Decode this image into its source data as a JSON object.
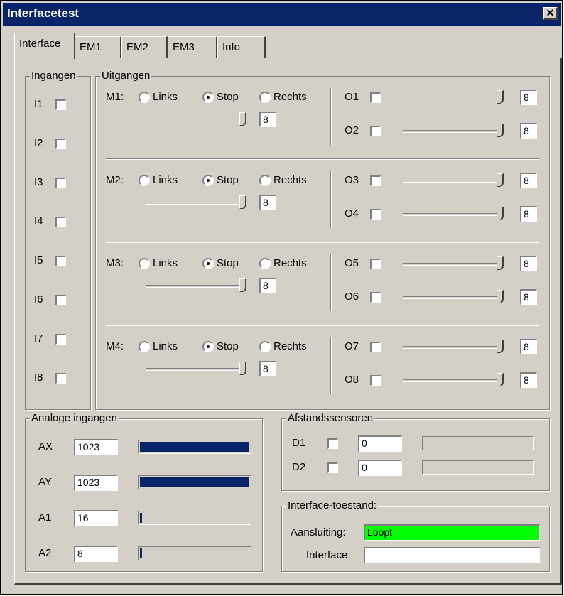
{
  "window": {
    "title": "Interfacetest",
    "close_glyph": "✕"
  },
  "tabs": [
    {
      "label": "Interface",
      "active": true
    },
    {
      "label": "EM1"
    },
    {
      "label": "EM2"
    },
    {
      "label": "EM3"
    },
    {
      "label": "Info"
    }
  ],
  "ingangen": {
    "title": "Ingangen",
    "items": [
      {
        "label": "I1",
        "checked": false
      },
      {
        "label": "I2",
        "checked": false
      },
      {
        "label": "I3",
        "checked": false
      },
      {
        "label": "I4",
        "checked": false
      },
      {
        "label": "I5",
        "checked": false
      },
      {
        "label": "I6",
        "checked": false
      },
      {
        "label": "I7",
        "checked": false
      },
      {
        "label": "I8",
        "checked": false
      }
    ]
  },
  "uitgangen": {
    "title": "Uitgangen",
    "radio_labels": {
      "links": "Links",
      "stop": "Stop",
      "rechts": "Rechts"
    },
    "motors": [
      {
        "label": "M1:",
        "selected": "stop",
        "speed": "8",
        "outputs": [
          {
            "label": "O1",
            "checked": false,
            "value": "8"
          },
          {
            "label": "O2",
            "checked": false,
            "value": "8"
          }
        ]
      },
      {
        "label": "M2:",
        "selected": "stop",
        "speed": "8",
        "outputs": [
          {
            "label": "O3",
            "checked": false,
            "value": "8"
          },
          {
            "label": "O4",
            "checked": false,
            "value": "8"
          }
        ]
      },
      {
        "label": "M3:",
        "selected": "stop",
        "speed": "8",
        "outputs": [
          {
            "label": "O5",
            "checked": false,
            "value": "8"
          },
          {
            "label": "O6",
            "checked": false,
            "value": "8"
          }
        ]
      },
      {
        "label": "M4:",
        "selected": "stop",
        "speed": "8",
        "outputs": [
          {
            "label": "O7",
            "checked": false,
            "value": "8"
          },
          {
            "label": "O8",
            "checked": false,
            "value": "8"
          }
        ]
      }
    ]
  },
  "analoge": {
    "title": "Analoge ingangen",
    "bar_color": "#0a246a",
    "items": [
      {
        "label": "AX",
        "value": "1023",
        "level": 1.0
      },
      {
        "label": "AY",
        "value": "1023",
        "level": 1.0
      },
      {
        "label": "A1",
        "value": "16",
        "level": 0.016
      },
      {
        "label": "A2",
        "value": "8",
        "level": 0.008
      }
    ]
  },
  "afstand": {
    "title": "Afstandssensoren",
    "items": [
      {
        "label": "D1",
        "checked": false,
        "value": "0",
        "level": 0
      },
      {
        "label": "D2",
        "checked": false,
        "value": "0",
        "level": 0
      }
    ]
  },
  "toestand": {
    "title": "Interface-toestand:",
    "aansluiting_label": "Aansluiting:",
    "aansluiting_value": "Loopt",
    "aansluiting_color": "#00ff00",
    "interface_label": "Interface:",
    "interface_value": ""
  }
}
